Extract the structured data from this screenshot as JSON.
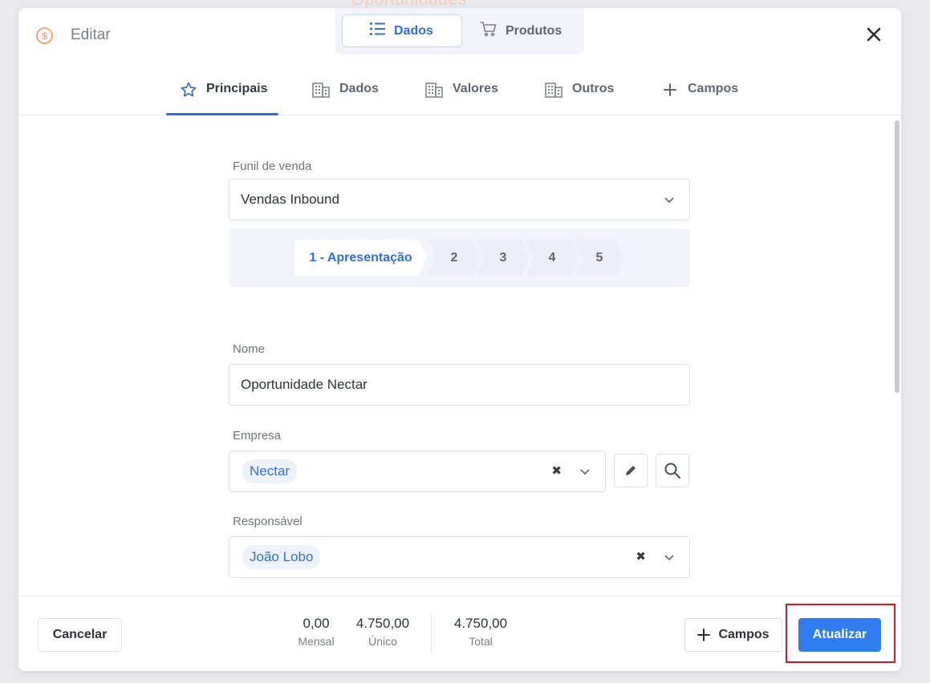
{
  "background_title": "Oportunidades",
  "header": {
    "icon": "dollar-circle-icon",
    "title": "Editar",
    "view_toggle": [
      {
        "label": "Dados",
        "icon": "list-icon",
        "active": true
      },
      {
        "label": "Produtos",
        "icon": "cart-icon",
        "active": false
      }
    ],
    "close_icon": "close-icon"
  },
  "tabs": [
    {
      "label": "Principais",
      "icon": "star-icon",
      "active": true
    },
    {
      "label": "Dados",
      "icon": "building-icon",
      "active": false
    },
    {
      "label": "Valores",
      "icon": "building-icon",
      "active": false
    },
    {
      "label": "Outros",
      "icon": "building-icon",
      "active": false
    },
    {
      "label": "Campos",
      "icon": "plus-icon",
      "active": false
    }
  ],
  "form": {
    "funil": {
      "label": "Funil de venda",
      "value": "Vendas Inbound"
    },
    "stages": [
      {
        "label": "1 - Apresentação",
        "active": true
      },
      {
        "label": "2",
        "active": false
      },
      {
        "label": "3",
        "active": false
      },
      {
        "label": "4",
        "active": false
      },
      {
        "label": "5",
        "active": false
      }
    ],
    "nome": {
      "label": "Nome",
      "value": "Oportunidade Nectar"
    },
    "empresa": {
      "label": "Empresa",
      "value": "Nectar"
    },
    "responsavel": {
      "label": "Responsável",
      "value": "João Lobo"
    }
  },
  "footer": {
    "cancel_label": "Cancelar",
    "totals": [
      {
        "value": "0,00",
        "label": "Mensal"
      },
      {
        "value": "4.750,00",
        "label": "Único"
      },
      {
        "value": "4.750,00",
        "label": "Total"
      }
    ],
    "campos_label": "Campos",
    "update_label": "Atualizar"
  },
  "colors": {
    "accent": "#2f6ee6",
    "primary_button": "#2f7bf0",
    "highlight": "#e0161c",
    "header_icon": "#f5a46b"
  }
}
